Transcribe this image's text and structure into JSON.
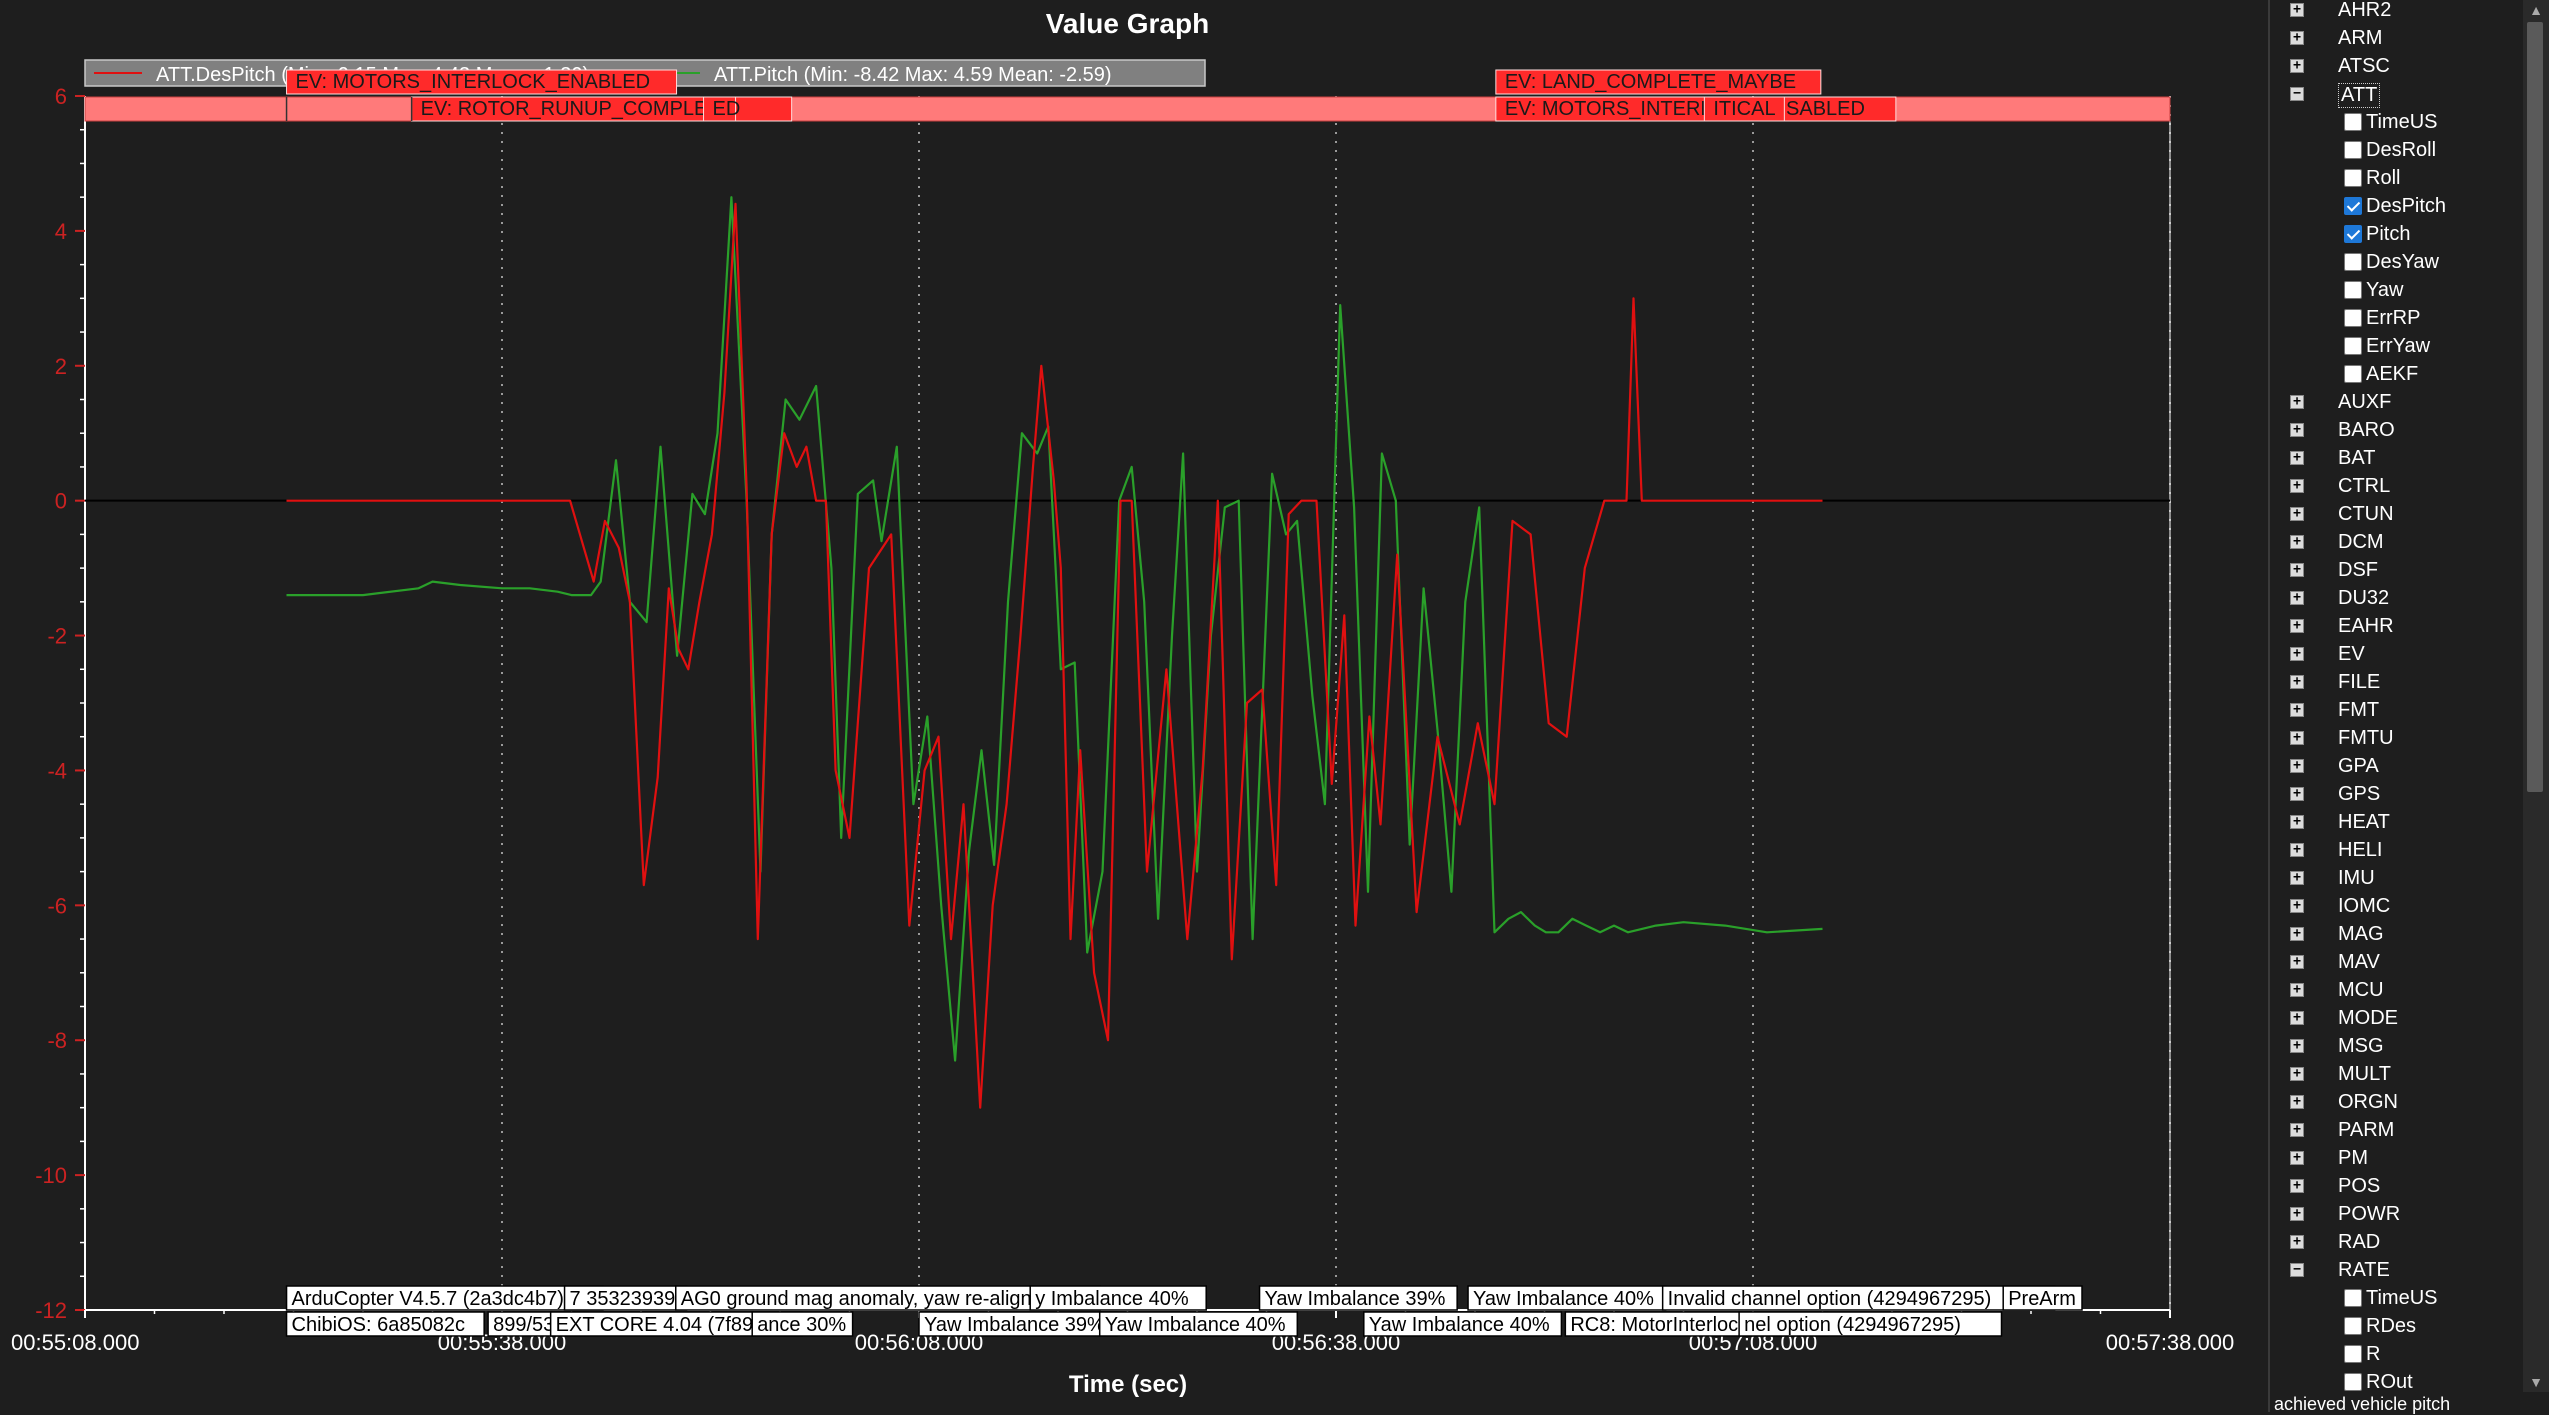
{
  "title": "Value Graph",
  "chart_data": {
    "type": "line",
    "xlabel": "Time (sec)",
    "ylim": [
      -12,
      6
    ],
    "yticks": [
      "6",
      "4",
      "2",
      "0",
      "-2",
      "-4",
      "-6",
      "-8",
      "-10",
      "-12"
    ],
    "xticks": [
      "00:55:08.000",
      "00:55:38.000",
      "00:56:08.000",
      "00:56:38.000",
      "00:57:08.000",
      "00:57:38.000"
    ],
    "series": [
      {
        "name": "ATT.DesPitch",
        "legend": "ATT.DesPitch (Min: -9.15 Max: 4.43 Mean: -1.30)",
        "color": "#e01010",
        "x": [
          14.5,
          20,
          25,
          34.9,
          36.6,
          37.4,
          38.4,
          39.2,
          40.2,
          41.2,
          42,
          42.7,
          43.4,
          44.2,
          45.1,
          46,
          46.8,
          47.6,
          48.4,
          49.4,
          50.3,
          51.2,
          51.9,
          52.6,
          53.3,
          54,
          55,
          56.4,
          58,
          59.3,
          60.4,
          61.4,
          62.3,
          63.2,
          64.4,
          65.3,
          66.3,
          67.3,
          68.2,
          68.8,
          69.7,
          70.2,
          70.9,
          71.6,
          72.6,
          73.6,
          74.5,
          75.3,
          76.4,
          77.8,
          79.3,
          80.4,
          81.5,
          82.5,
          83.6,
          84.7,
          85.7,
          86.6,
          87.5,
          88.6,
          89.7,
          90.6,
          91.4,
          92.4,
          93.2,
          94.4,
          95.8,
          97.3,
          98.9,
          100.2,
          101.4,
          102.7,
          104,
          105.3,
          106.6,
          107.9,
          109.3,
          110.4,
          110.9,
          111.4,
          112,
          116,
          118,
          125
        ],
        "y": [
          0,
          0,
          0,
          0,
          -1.2,
          -0.3,
          -0.7,
          -1.5,
          -5.7,
          -4.1,
          -1.3,
          -2.2,
          -2.5,
          -1.5,
          -0.5,
          1.6,
          4.4,
          0.2,
          -6.5,
          -0.5,
          1.0,
          0.5,
          0.8,
          0,
          0,
          -4,
          -5,
          -1,
          -0.5,
          -6.3,
          -4.0,
          -3.5,
          -6.5,
          -4.5,
          -9.0,
          -6,
          -4.5,
          -2,
          0.5,
          2.0,
          0.3,
          -1,
          -6.5,
          -3.7,
          -7.0,
          -8.0,
          0,
          0,
          -5.5,
          -2.5,
          -6.5,
          -4.0,
          0,
          -6.8,
          -3.0,
          -2.8,
          -5.7,
          -0.2,
          0,
          0,
          -4.2,
          -1.7,
          -6.3,
          -3.2,
          -4.8,
          -0.8,
          -6.1,
          -3.5,
          -4.8,
          -3.3,
          -4.5,
          -0.3,
          -0.5,
          -3.3,
          -3.5,
          -1.0,
          0,
          0,
          0,
          3.0,
          0,
          0,
          0,
          0
        ]
      },
      {
        "name": "ATT.Pitch",
        "legend": "ATT.Pitch (Min: -8.42 Max: 4.59 Mean: -2.59)",
        "color": "#2aa02a",
        "x": [
          14.5,
          20,
          24,
          25,
          27,
          30,
          32,
          34,
          35,
          36.4,
          37.1,
          38.2,
          39.2,
          40.4,
          41.4,
          42.6,
          43.7,
          44.6,
          45.5,
          46.5,
          47.6,
          48.6,
          49.4,
          50.4,
          51.4,
          52.6,
          53.7,
          54.4,
          55.6,
          56.7,
          57.3,
          58.4,
          59.6,
          60.6,
          61.6,
          62.6,
          63.6,
          64.5,
          65.4,
          66.4,
          67.4,
          68.5,
          69.3,
          70.2,
          71.2,
          72.1,
          73.2,
          74.4,
          75.3,
          76.2,
          77.2,
          78.2,
          79,
          80,
          81,
          82,
          83,
          84,
          85.4,
          86.4,
          87.2,
          88.3,
          89.2,
          90.3,
          91.3,
          92.3,
          93.3,
          94.3,
          95.3,
          96.3,
          97.3,
          98.3,
          99.3,
          100.3,
          101.4,
          102.4,
          103.3,
          104.3,
          105.1,
          106,
          107,
          108,
          109,
          110,
          111,
          113,
          115,
          118,
          121,
          125
        ],
        "y": [
          -1.4,
          -1.4,
          -1.3,
          -1.2,
          -1.25,
          -1.3,
          -1.3,
          -1.35,
          -1.4,
          -1.4,
          -1.2,
          0.6,
          -1.5,
          -1.8,
          0.8,
          -2.3,
          0.1,
          -0.2,
          1.0,
          4.5,
          0,
          -5.5,
          -0.5,
          1.5,
          1.2,
          1.7,
          -1.0,
          -5.0,
          0.1,
          0.3,
          -0.6,
          0.8,
          -4.5,
          -3.2,
          -6.0,
          -8.3,
          -5.2,
          -3.7,
          -5.4,
          -1.5,
          1.0,
          0.7,
          1.1,
          -2.5,
          -2.4,
          -6.7,
          -5.5,
          0,
          0.5,
          -1.5,
          -6.2,
          -2.0,
          0.7,
          -5.5,
          -2.0,
          -0.1,
          0,
          -6.5,
          0.4,
          -0.5,
          -0.3,
          -2.9,
          -4.5,
          2.9,
          -0.1,
          -5.8,
          0.7,
          0,
          -5.1,
          -1.3,
          -3.4,
          -5.8,
          -1.5,
          -0.1,
          -6.4,
          -6.2,
          -6.1,
          -6.3,
          -6.4,
          -6.4,
          -6.2,
          -6.3,
          -6.4,
          -6.3,
          -6.4,
          -6.3,
          -6.25,
          -6.3,
          -6.4,
          -6.35
        ]
      }
    ],
    "events": [
      {
        "label": "EV: MOTORS_INTERLOCK_ENABLED",
        "t": 14.5
      },
      {
        "label": "EV: ROTOR_RUNUP_COMPLETE",
        "t": 23.5
      },
      {
        "label": "ED",
        "t": 44.5
      },
      {
        "label": "EV: LAND_COMPLETE_MAYBE",
        "t": 101.5
      },
      {
        "label": "EV: MOTORS_INTERLOCK_DISABLED",
        "t": 101.5
      },
      {
        "label": "ITICAL",
        "t": 116.5
      }
    ],
    "messages_row1": [
      {
        "label": "ArduCopter V4.5.7 (2a3dc4b7)",
        "t": 14.5
      },
      {
        "label": "7 35323939",
        "t": 34.5
      },
      {
        "label": "AG0 ground mag anomaly, yaw re-aligned",
        "t": 42.5
      },
      {
        "label": "y Imbalance 40%",
        "t": 68.0
      },
      {
        "label": "Yaw Imbalance 39%",
        "t": 84.5
      },
      {
        "label": "Yaw Imbalance 40%",
        "t": 99.5
      },
      {
        "label": "Invalid channel option (4294967295)",
        "t": 113.5
      },
      {
        "label": "PreArm",
        "t": 138.0
      }
    ],
    "messages_row2": [
      {
        "label": "ChibiOS: 6a85082c",
        "t": 14.5
      },
      {
        "label": "899/5376",
        "t": 29.0
      },
      {
        "label": "EXT CORE 4.04 (7f89f7)",
        "t": 33.5
      },
      {
        "label": "ance 30%",
        "t": 48.0
      },
      {
        "label": "Yaw Imbalance 39%",
        "t": 60.0
      },
      {
        "label": "Yaw Imbalance 40%",
        "t": 73.0
      },
      {
        "label": "Yaw Imbalance 40%",
        "t": 92.0
      },
      {
        "label": "RC8: MotorInterlock LOW",
        "t": 106.5
      },
      {
        "label": "nel option (4294967295)",
        "t": 119.0
      }
    ]
  },
  "tree": {
    "items": [
      {
        "label": "AHR2",
        "level": 0,
        "expanded": false
      },
      {
        "label": "ARM",
        "level": 0,
        "expanded": false
      },
      {
        "label": "ATSC",
        "level": 0,
        "expanded": false
      },
      {
        "label": "ATT",
        "level": 0,
        "expanded": true,
        "selected": true
      },
      {
        "label": "TimeUS",
        "level": 1,
        "checked": false
      },
      {
        "label": "DesRoll",
        "level": 1,
        "checked": false
      },
      {
        "label": "Roll",
        "level": 1,
        "checked": false
      },
      {
        "label": "DesPitch",
        "level": 1,
        "checked": true
      },
      {
        "label": "Pitch",
        "level": 1,
        "checked": true
      },
      {
        "label": "DesYaw",
        "level": 1,
        "checked": false
      },
      {
        "label": "Yaw",
        "level": 1,
        "checked": false
      },
      {
        "label": "ErrRP",
        "level": 1,
        "checked": false
      },
      {
        "label": "ErrYaw",
        "level": 1,
        "checked": false
      },
      {
        "label": "AEKF",
        "level": 1,
        "checked": false
      },
      {
        "label": "AUXF",
        "level": 0,
        "expanded": false
      },
      {
        "label": "BARO",
        "level": 0,
        "expanded": false
      },
      {
        "label": "BAT",
        "level": 0,
        "expanded": false
      },
      {
        "label": "CTRL",
        "level": 0,
        "expanded": false
      },
      {
        "label": "CTUN",
        "level": 0,
        "expanded": false
      },
      {
        "label": "DCM",
        "level": 0,
        "expanded": false
      },
      {
        "label": "DSF",
        "level": 0,
        "expanded": false
      },
      {
        "label": "DU32",
        "level": 0,
        "expanded": false
      },
      {
        "label": "EAHR",
        "level": 0,
        "expanded": false
      },
      {
        "label": "EV",
        "level": 0,
        "expanded": false
      },
      {
        "label": "FILE",
        "level": 0,
        "expanded": false
      },
      {
        "label": "FMT",
        "level": 0,
        "expanded": false
      },
      {
        "label": "FMTU",
        "level": 0,
        "expanded": false
      },
      {
        "label": "GPA",
        "level": 0,
        "expanded": false
      },
      {
        "label": "GPS",
        "level": 0,
        "expanded": false
      },
      {
        "label": "HEAT",
        "level": 0,
        "expanded": false
      },
      {
        "label": "HELI",
        "level": 0,
        "expanded": false
      },
      {
        "label": "IMU",
        "level": 0,
        "expanded": false
      },
      {
        "label": "IOMC",
        "level": 0,
        "expanded": false
      },
      {
        "label": "MAG",
        "level": 0,
        "expanded": false
      },
      {
        "label": "MAV",
        "level": 0,
        "expanded": false
      },
      {
        "label": "MCU",
        "level": 0,
        "expanded": false
      },
      {
        "label": "MODE",
        "level": 0,
        "expanded": false
      },
      {
        "label": "MSG",
        "level": 0,
        "expanded": false
      },
      {
        "label": "MULT",
        "level": 0,
        "expanded": false
      },
      {
        "label": "ORGN",
        "level": 0,
        "expanded": false
      },
      {
        "label": "PARM",
        "level": 0,
        "expanded": false
      },
      {
        "label": "PM",
        "level": 0,
        "expanded": false
      },
      {
        "label": "POS",
        "level": 0,
        "expanded": false
      },
      {
        "label": "POWR",
        "level": 0,
        "expanded": false
      },
      {
        "label": "RAD",
        "level": 0,
        "expanded": false
      },
      {
        "label": "RATE",
        "level": 0,
        "expanded": true
      },
      {
        "label": "TimeUS",
        "level": 1,
        "checked": false
      },
      {
        "label": "RDes",
        "level": 1,
        "checked": false
      },
      {
        "label": "R",
        "level": 1,
        "checked": false
      },
      {
        "label": "ROut",
        "level": 1,
        "checked": false
      }
    ]
  },
  "status_text": "achieved vehicle pitch",
  "colors": {
    "background": "#1e1e1e",
    "axis_label": "#cc2222",
    "event_fill": "#ff2a2a",
    "event_band": "#ff7a7a",
    "checkbox_checked": "#1e78d8"
  }
}
